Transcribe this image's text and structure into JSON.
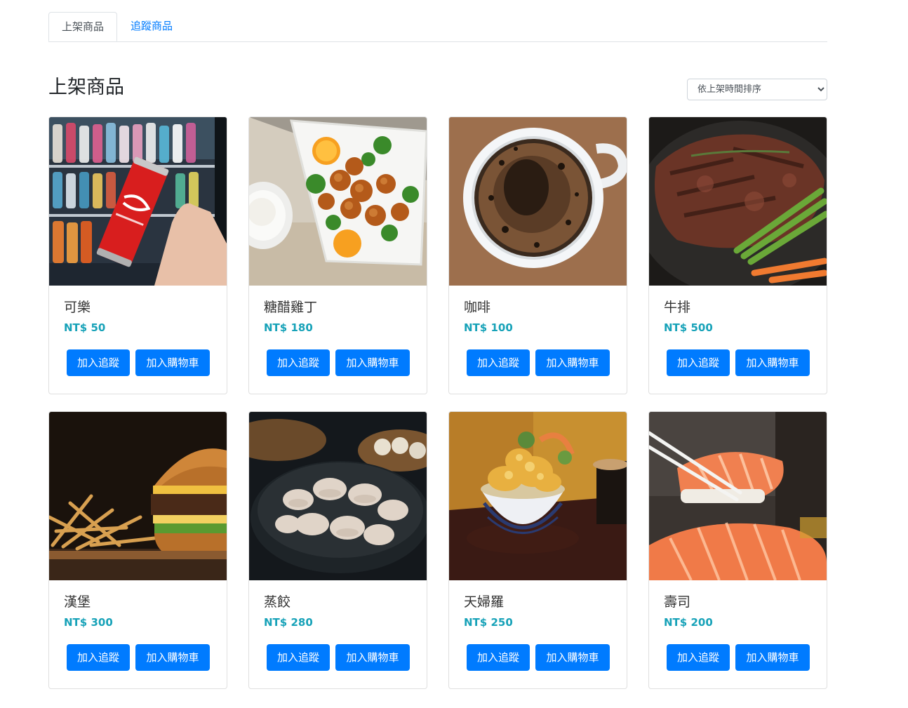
{
  "tabs": [
    {
      "label": "上架商品",
      "active": true
    },
    {
      "label": "追蹤商品",
      "active": false
    }
  ],
  "section": {
    "title": "上架商品",
    "sort": {
      "selected": "依上架時間排序",
      "options": [
        "依上架時間排序"
      ]
    }
  },
  "products": [
    {
      "name": "可樂",
      "price": "NT$ 50",
      "image": "cola-can-photo"
    },
    {
      "name": "糖醋雞丁",
      "price": "NT$ 180",
      "image": "sweet-sour-chicken-photo"
    },
    {
      "name": "咖啡",
      "price": "NT$ 100",
      "image": "coffee-cup-photo"
    },
    {
      "name": "牛排",
      "price": "NT$ 500",
      "image": "steak-photo"
    },
    {
      "name": "漢堡",
      "price": "NT$ 300",
      "image": "burger-fries-photo"
    },
    {
      "name": "蒸餃",
      "price": "NT$ 280",
      "image": "steamed-dumplings-photo"
    },
    {
      "name": "天婦羅",
      "price": "NT$ 250",
      "image": "tempura-bowl-photo"
    },
    {
      "name": "壽司",
      "price": "NT$ 200",
      "image": "salmon-sushi-photo"
    }
  ],
  "buttons": {
    "track": "加入追蹤",
    "cart": "加入購物車"
  },
  "colors": {
    "primary": "#007bff",
    "price": "#17a2b8",
    "border": "#dee2e6"
  }
}
